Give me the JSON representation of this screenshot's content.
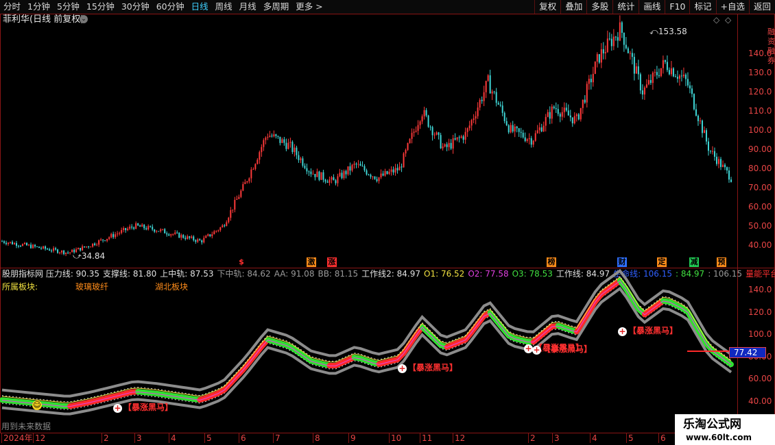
{
  "toolbar": {
    "periods": [
      "分时",
      "1分钟",
      "5分钟",
      "15分钟",
      "30分钟",
      "60分钟",
      "日线",
      "周线",
      "月线",
      "多周期",
      "更多 >"
    ],
    "active_period": "日线",
    "right_buttons": [
      "复权",
      "叠加",
      "多股",
      "统计",
      "画线",
      "F10",
      "标记",
      "+自选",
      "返回"
    ]
  },
  "main_chart": {
    "title": "菲利华(日线 前复权)",
    "high_label": "153.58",
    "low_label": "34.84",
    "y_axis": [
      "140.0",
      "130.0",
      "120.0",
      "110.0",
      "100.0",
      "90.00",
      "80.00",
      "70.00",
      "60.00",
      "50.00",
      "40.00"
    ],
    "side_text": "融资融券"
  },
  "event_markers": [
    {
      "label": "$",
      "color": "#ff3030"
    },
    {
      "label": "激",
      "color": "#ff8c1a"
    },
    {
      "label": "涨",
      "color": "#ff3030"
    },
    {
      "label": "榜",
      "color": "#ff8c1a"
    },
    {
      "label": "财",
      "color": "#2f6fff"
    },
    {
      "label": "定",
      "color": "#ff8c1a"
    },
    {
      "label": "减",
      "color": "#22cc55"
    },
    {
      "label": "预",
      "color": "#ff8c1a"
    }
  ],
  "indicator": {
    "name": "股朋指标网",
    "values": [
      {
        "label": "压力线: 90.35",
        "color": "#e0e0e0"
      },
      {
        "label": "支撑线: 81.80",
        "color": "#e0e0e0"
      },
      {
        "label": "上中轨: 87.53",
        "color": "#e0e0e0"
      },
      {
        "label": "下中轨: 84.62",
        "color": "#9a9a9a"
      },
      {
        "label": "AA: 91.08",
        "color": "#9a9a9a"
      },
      {
        "label": "BB: 81.15",
        "color": "#9a9a9a"
      },
      {
        "label": "工作线2: 84.97",
        "color": "#e0e0e0"
      },
      {
        "label": "O1: 76.52",
        "color": "#f0e040"
      },
      {
        "label": "O2: 77.58",
        "color": "#e040e0"
      },
      {
        "label": "O3: 78.53",
        "color": "#40e040"
      },
      {
        "label": "工作线: 84.97",
        "color": "#e0e0e0"
      },
      {
        "label": "生命线: 106.15",
        "color": "#3060ff"
      },
      {
        "label": ": 84.97",
        "color": "#40e040"
      },
      {
        "label": ": 106.15",
        "color": "#9a9a9a"
      },
      {
        "label": "量能平台",
        "color": "#ff3030"
      }
    ],
    "sector_label": "所属板块:",
    "sectors": [
      "玻璃玻纤",
      "湖北板块"
    ],
    "y_axis": [
      "140.0",
      "120.0",
      "100.0",
      "80.00",
      "60.00",
      "40.00"
    ],
    "current_price": "77.42",
    "buy_signal_text": "暴涨黑马",
    "future_data_text": "用到未来数据"
  },
  "x_axis": [
    "2024年",
    "12",
    "2",
    "3",
    "4",
    "5",
    "6",
    "7",
    "8",
    "9",
    "10",
    "11",
    "12",
    "2",
    "3",
    "4",
    "5",
    "6"
  ],
  "watermark": {
    "title": "乐淘公式网",
    "url": "www.60lt.com"
  },
  "colors": {
    "up": "#ff3a3a",
    "down": "#3fd6d6",
    "axis": "#e84545",
    "frame": "#8a1515"
  },
  "chart_data": {
    "type": "line",
    "title": "菲利华(日线 前复权)",
    "high": 153.58,
    "low": 34.84,
    "current_price": 77.42,
    "ylim": [
      35,
      155
    ],
    "x": [
      "2024年",
      "12",
      "2",
      "3",
      "4",
      "5",
      "6",
      "7",
      "8",
      "9",
      "10",
      "11",
      "12",
      "2",
      "3",
      "4",
      "5",
      "6"
    ],
    "series": [
      {
        "values": [
          42,
          40,
          38,
          36,
          40,
          45,
          50,
          48,
          45,
          42,
          50,
          72,
          98,
          92,
          78,
          73,
          82,
          75,
          80,
          110,
          90,
          98,
          125,
          100,
          95,
          112,
          105,
          138,
          153,
          120,
          135,
          125,
          90,
          75
        ]
      }
    ]
  }
}
